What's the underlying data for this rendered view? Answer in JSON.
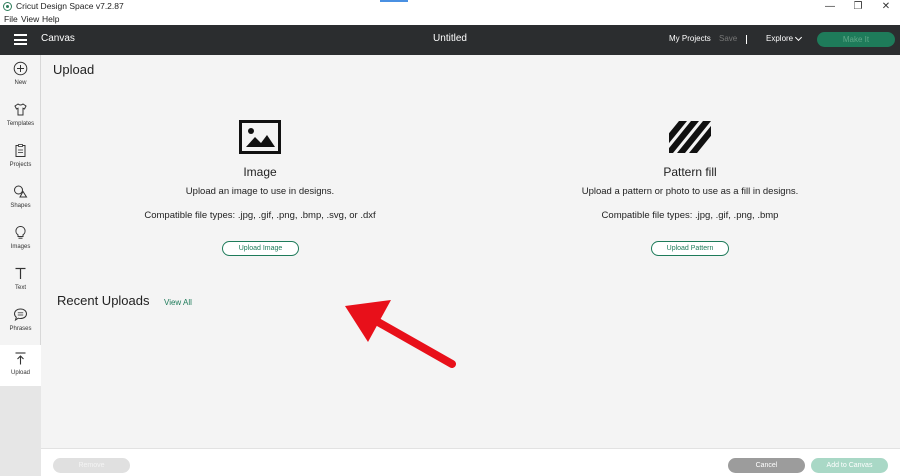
{
  "window": {
    "title": "Cricut Design Space  v7.2.87",
    "min_glyph": "—",
    "restore_glyph": "❐",
    "close_glyph": "✕"
  },
  "menu": [
    "File",
    "View",
    "Help"
  ],
  "header": {
    "section": "Canvas",
    "document_title": "Untitled",
    "my_projects": "My Projects",
    "save": "Save",
    "separator": "|",
    "explore": "Explore",
    "make_it": "Make It"
  },
  "sidebar": {
    "items": [
      {
        "label": "New",
        "icon": "plus-circle-icon"
      },
      {
        "label": "Templates",
        "icon": "shirt-icon"
      },
      {
        "label": "Projects",
        "icon": "clipboard-icon"
      },
      {
        "label": "Shapes",
        "icon": "shapes-icon"
      },
      {
        "label": "Images",
        "icon": "lightbulb-icon"
      },
      {
        "label": "Text",
        "icon": "text-t-icon"
      },
      {
        "label": "Phrases",
        "icon": "speech-bubble-icon"
      },
      {
        "label": "Upload",
        "icon": "upload-icon"
      }
    ],
    "active": "Upload"
  },
  "main": {
    "page_title": "Upload",
    "image_card": {
      "title": "Image",
      "description": "Upload an image to use in designs.",
      "file_types": "Compatible file types: .jpg, .gif, .png, .bmp, .svg, or .dxf",
      "button": "Upload Image",
      "icon": "image-frame-icon"
    },
    "pattern_card": {
      "title": "Pattern fill",
      "description": "Upload a pattern or photo to use as a fill in designs.",
      "file_types": "Compatible file types: .jpg, .gif, .png, .bmp",
      "button": "Upload Pattern",
      "icon": "diagonal-stripes-icon"
    },
    "recent_title": "Recent Uploads",
    "view_all": "View All"
  },
  "footer": {
    "remove": "Remove",
    "cancel": "Cancel",
    "add_to_canvas": "Add to Canvas"
  },
  "colors": {
    "header_bg": "#2b2d2f",
    "accent_green": "#1e7b5a",
    "annotation_arrow": "#e8101a"
  }
}
